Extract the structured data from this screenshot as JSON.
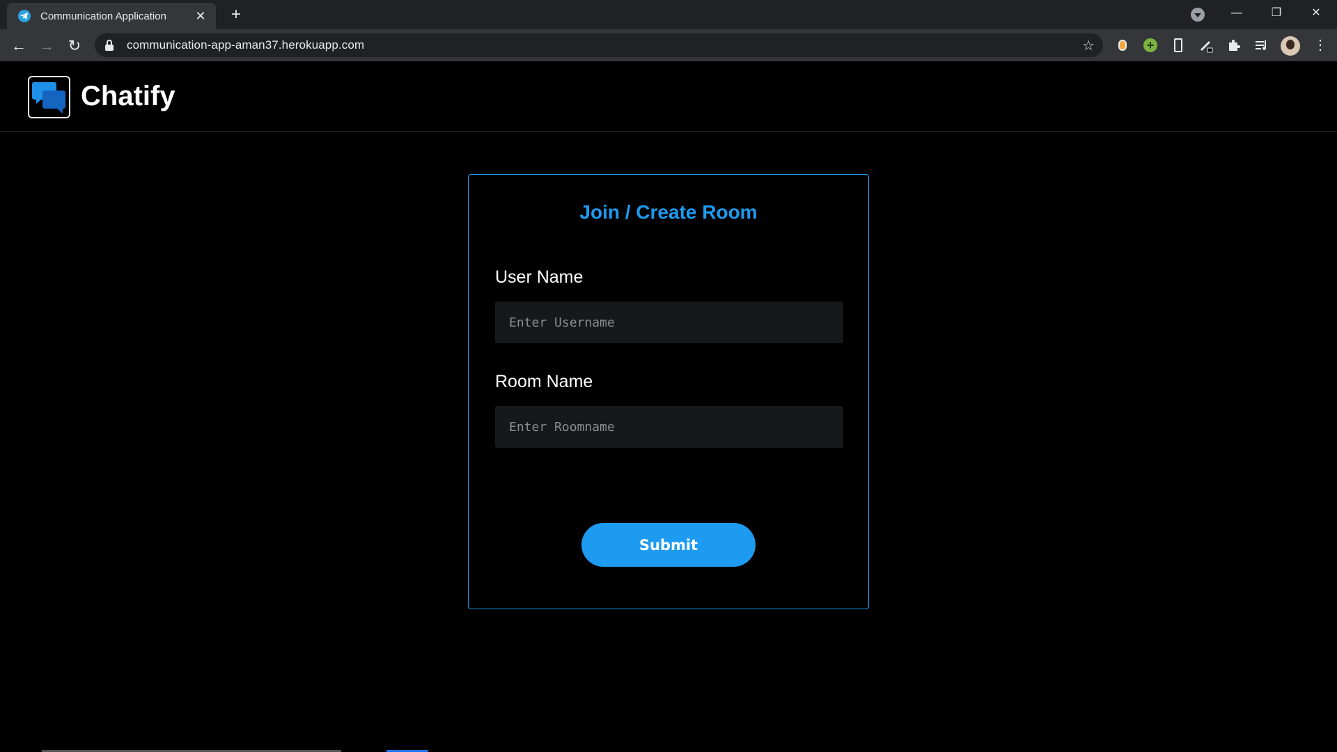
{
  "browser": {
    "tab_title": "Communication Application",
    "tab_close": "✕",
    "new_tab": "+",
    "url": "communication-app-aman37.herokuapp.com",
    "window_controls": {
      "minimize": "—",
      "restore": "❐",
      "close": "✕"
    },
    "nav": {
      "back": "←",
      "forward": "→",
      "reload": "↻"
    },
    "star": "☆",
    "extensions": [
      "orange-extension-icon",
      "green-plus-extension-icon",
      "phone-extension-icon",
      "pen-extension-icon",
      "puzzle-icon",
      "media-icon"
    ],
    "menu": "⋮",
    "colors": {
      "tabstrip": "#202124",
      "toolbar": "#35363a",
      "omnibox": "#202124"
    }
  },
  "app": {
    "brand": "Chatify",
    "logo_icon": "chat-bubbles-icon"
  },
  "form": {
    "title": "Join / Create Room",
    "username_label": "User Name",
    "username_placeholder": "Enter Username",
    "roomname_label": "Room Name",
    "roomname_placeholder": "Enter Roomname",
    "submit_label": "Submit"
  },
  "theme": {
    "accent": "#1d9bf0",
    "background": "#000000",
    "input_bg": "#16181c"
  }
}
